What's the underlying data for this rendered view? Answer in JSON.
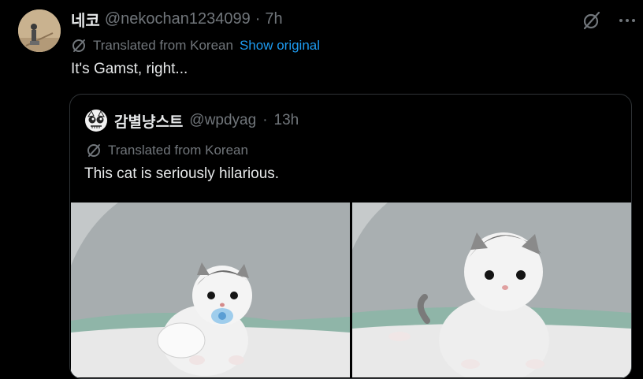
{
  "tweet": {
    "display_name": "네코",
    "handle": "@nekochan1234099",
    "separator": "·",
    "time": "7h",
    "translated_label": "Translated from Korean",
    "show_original_label": "Show original",
    "text": "It's Gamst, right..."
  },
  "quote": {
    "display_name": "감별냥스트",
    "handle": "@wpdyag",
    "separator": "·",
    "time": "13h",
    "translated_label": "Translated from Korean",
    "text": "This cat is seriously hilarious."
  },
  "media": [
    {
      "subject": "kitten-with-pacifier"
    },
    {
      "subject": "kitten-sitting"
    }
  ],
  "colors": {
    "background": "#000000",
    "text_primary": "#e7e9ea",
    "text_secondary": "#71767b",
    "link": "#1d9bf0",
    "border": "#2f3336"
  }
}
